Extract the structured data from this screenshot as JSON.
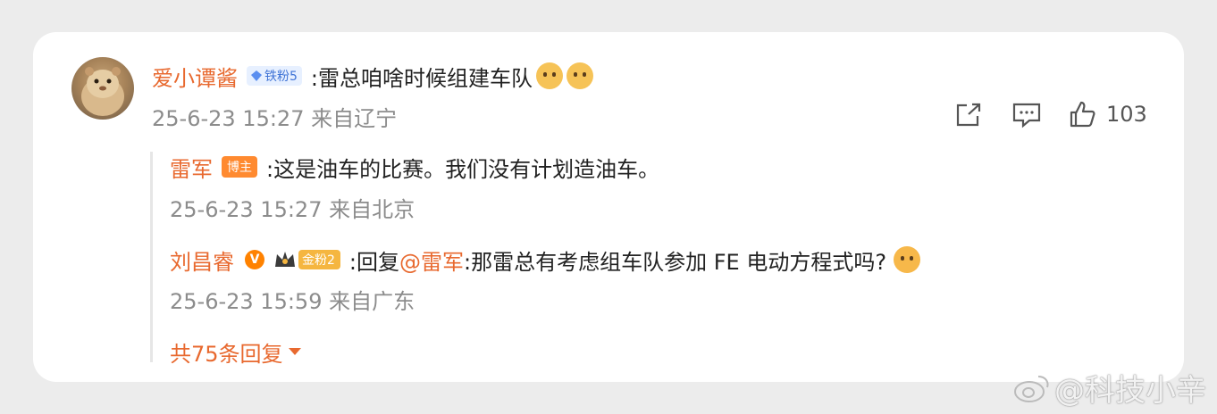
{
  "comment": {
    "user": "爱小谭酱",
    "fan_badge": "铁粉5",
    "text": ":雷总咱啥时候组建车队",
    "time": "25-6-23 15:27 来自辽宁",
    "like_count": "103"
  },
  "replies": [
    {
      "user": "雷军",
      "role_badge": "博主",
      "text": ":这是油车的比赛。我们没有计划造油车。",
      "time": "25-6-23 15:27 来自北京"
    },
    {
      "user": "刘昌睿",
      "vip_badge": "V",
      "fan_badge": "金粉2",
      "text_prefix": ":回复",
      "mention": "@雷军",
      "text": ":那雷总有考虑组车队参加 FE 电动方程式吗?",
      "time": "25-6-23 15:59 来自广东"
    }
  ],
  "more_replies": "共75条回复",
  "watermark": "@科技小辛",
  "icons": {
    "share": "share-icon",
    "comment": "comment-icon",
    "like": "like-icon",
    "weibo": "weibo-logo-icon"
  },
  "colors": {
    "accent": "#e8692f",
    "text": "#222222",
    "meta": "#8c8c8c"
  }
}
